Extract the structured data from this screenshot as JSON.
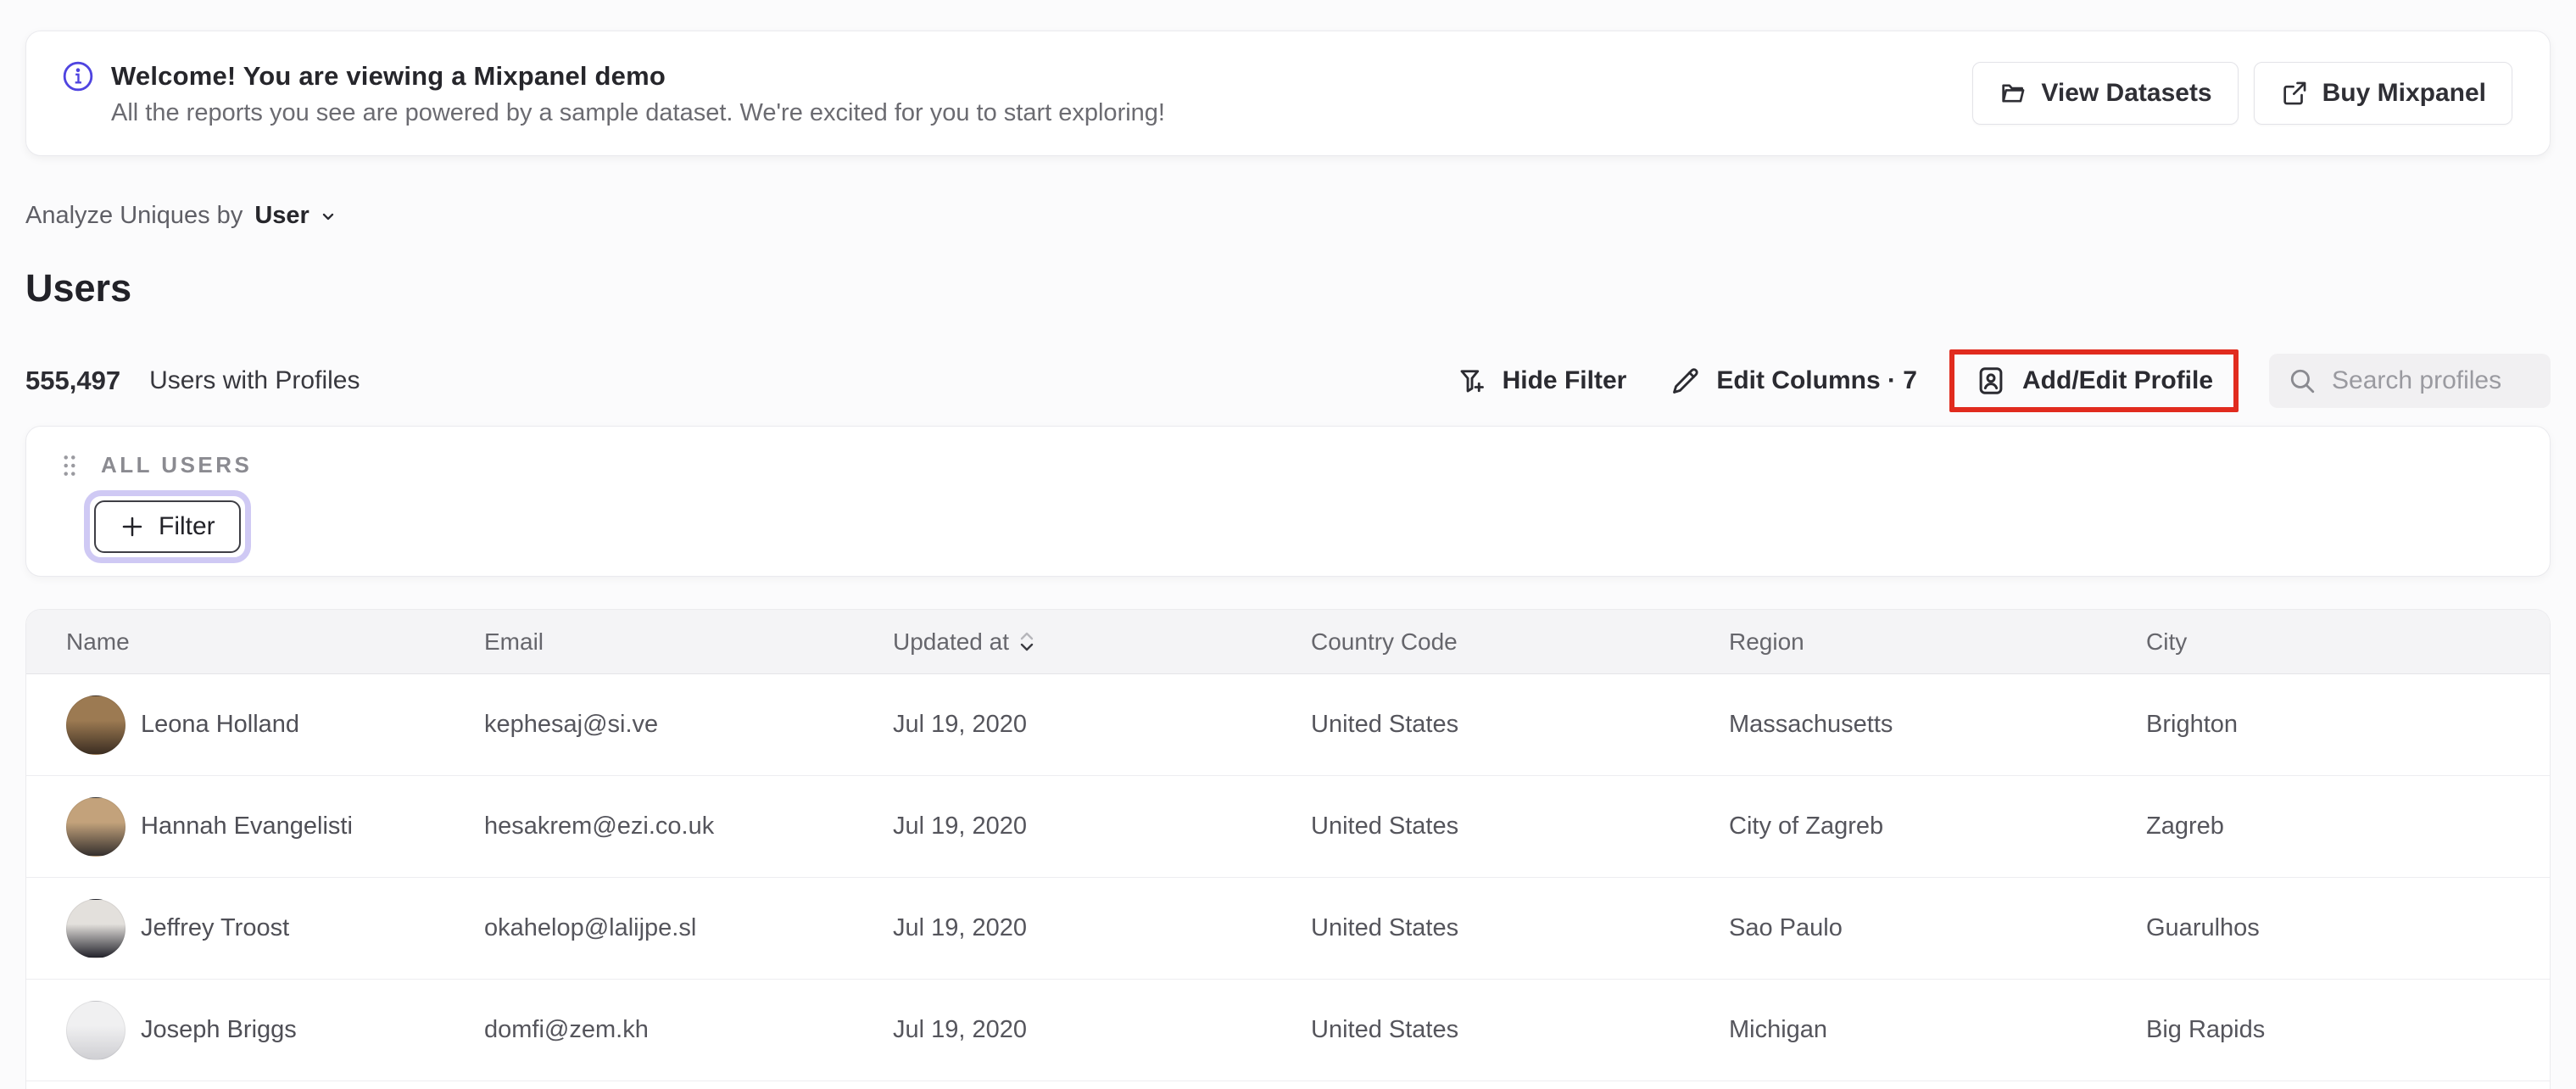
{
  "banner": {
    "title": "Welcome! You are viewing a Mixpanel demo",
    "subtitle": "All the reports you see are powered by a sample dataset. We're excited for you to start exploring!",
    "view_datasets_label": "View Datasets",
    "buy_mixpanel_label": "Buy Mixpanel"
  },
  "controls": {
    "analyze_label": "Analyze Uniques by",
    "analyze_value": "User"
  },
  "page_title": "Users",
  "summary": {
    "count": "555,497",
    "label": "Users with Profiles"
  },
  "toolbar": {
    "hide_filter_label": "Hide Filter",
    "edit_columns_label": "Edit Columns · 7",
    "add_edit_profile_label": "Add/Edit Profile",
    "search_placeholder": "Search profiles"
  },
  "filter_panel": {
    "group_label": "ALL USERS",
    "add_filter_label": "Filter"
  },
  "table": {
    "columns": [
      "Name",
      "Email",
      "Updated at",
      "Country Code",
      "Region",
      "City"
    ],
    "sorted_column": "Updated at",
    "sort_direction": "desc",
    "rows": [
      {
        "name": "Leona Holland",
        "email": "kephesaj@si.ve",
        "updated_at": "Jul 19, 2020",
        "country_code": "United States",
        "region": "Massachusetts",
        "city": "Brighton",
        "avatar": {
          "top": "#9c7a52",
          "bottom": "#3c2e22"
        }
      },
      {
        "name": "Hannah Evangelisti",
        "email": "hesakrem@ezi.co.uk",
        "updated_at": "Jul 19, 2020",
        "country_code": "United States",
        "region": "City of Zagreb",
        "city": "Zagreb",
        "avatar": {
          "top": "#c3a27b",
          "bottom": "#35302e"
        }
      },
      {
        "name": "Jeffrey Troost",
        "email": "okahelop@lalijpe.sl",
        "updated_at": "Jul 19, 2020",
        "country_code": "United States",
        "region": "Sao Paulo",
        "city": "Guarulhos",
        "avatar": {
          "top": "#e3e0dc",
          "bottom": "#23232b"
        }
      },
      {
        "name": "Joseph Briggs",
        "email": "domfi@zem.kh",
        "updated_at": "Jul 19, 2020",
        "country_code": "United States",
        "region": "Michigan",
        "city": "Big Rapids",
        "avatar": {
          "top": "#f0f0f1",
          "bottom": "#cfcfd3"
        }
      }
    ]
  },
  "colors": {
    "brand_purple": "#4f44e0",
    "annotation_red": "#e12b1e",
    "focus_ring_lavender": "#cfc9f4",
    "header_bg": "#f4f4f6",
    "search_bg": "#f1f0f2"
  }
}
